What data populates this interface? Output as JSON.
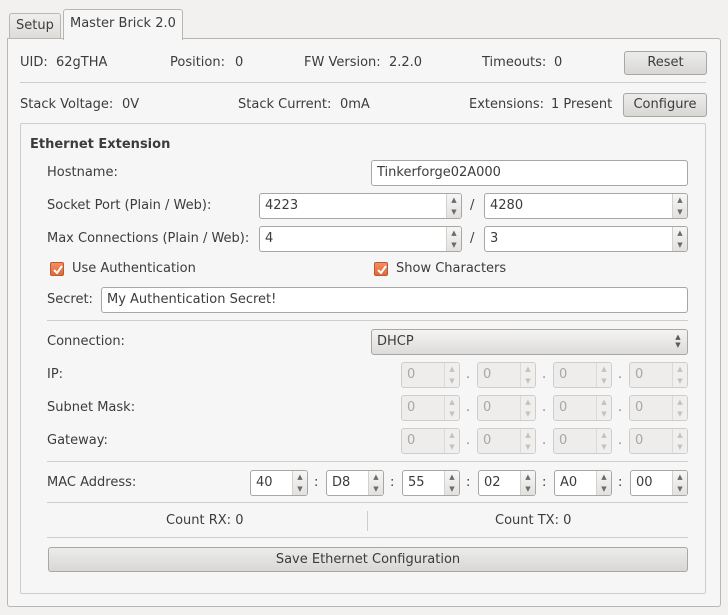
{
  "tabs": [
    {
      "label": "Setup",
      "active": false
    },
    {
      "label": "Master Brick 2.0",
      "active": true
    }
  ],
  "info": {
    "uid_label": "UID:",
    "uid_value": "62gTHA",
    "position_label": "Position:",
    "position_value": "0",
    "fw_label": "FW Version:",
    "fw_value": "2.2.0",
    "timeouts_label": "Timeouts:",
    "timeouts_value": "0",
    "reset_label": "Reset",
    "stack_voltage_label": "Stack Voltage:",
    "stack_voltage_value": "0V",
    "stack_current_label": "Stack Current:",
    "stack_current_value": "0mA",
    "extensions_label": "Extensions:",
    "extensions_value": "1 Present",
    "configure_label": "Configure"
  },
  "ethernet": {
    "title": "Ethernet Extension",
    "hostname_label": "Hostname:",
    "hostname_value": "Tinkerforge02A000",
    "socket_port_label": "Socket Port (Plain / Web):",
    "socket_port_plain": "4223",
    "socket_port_web": "4280",
    "max_conn_label": "Max Connections (Plain / Web):",
    "max_conn_plain": "4",
    "max_conn_web": "3",
    "slash": "/",
    "use_auth_label": "Use Authentication",
    "use_auth_checked": true,
    "show_chars_label": "Show Characters",
    "show_chars_checked": true,
    "secret_label": "Secret:",
    "secret_value": "My Authentication Secret!",
    "connection_label": "Connection:",
    "connection_value": "DHCP",
    "ip_label": "IP:",
    "ip": [
      "0",
      "0",
      "0",
      "0"
    ],
    "subnet_label": "Subnet Mask:",
    "subnet": [
      "0",
      "0",
      "0",
      "0"
    ],
    "gateway_label": "Gateway:",
    "gateway": [
      "0",
      "0",
      "0",
      "0"
    ],
    "dot": ".",
    "mac_label": "MAC Address:",
    "mac": [
      "40",
      "D8",
      "55",
      "02",
      "A0",
      "00"
    ],
    "colon": ":",
    "count_rx": "Count RX: 0",
    "count_tx": "Count TX: 0",
    "save_label": "Save Ethernet Configuration"
  },
  "icons": {
    "spin_up": "▲",
    "spin_down": "▼",
    "combo_up": "▲",
    "combo_down": "▼"
  },
  "colors": {
    "checkbox_accent": "#dd6a3c"
  }
}
